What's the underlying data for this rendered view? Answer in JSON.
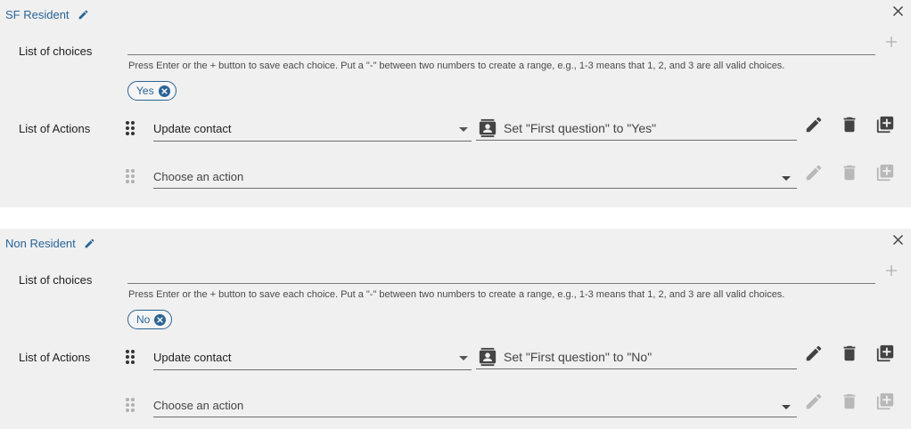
{
  "hint_text": "Press Enter or the + button to save each choice. Put a \"-\" between two numbers to create a range, e.g., 1-3 means that 1, 2, and 3 are all valid choices.",
  "labels": {
    "list_of_choices": "List of choices",
    "list_of_actions": "List of Actions",
    "choose_action_placeholder": "Choose an action"
  },
  "icons": {
    "edit": "pencil-icon",
    "close": "close-icon",
    "add": "plus-icon",
    "drag": "drag-handle-icon",
    "contact": "contact-icon",
    "delete": "trash-icon",
    "duplicate": "add-box-icon"
  },
  "colors": {
    "accent": "#2a6496",
    "card_bg": "#f0f0f0",
    "icon_dark": "#424242",
    "icon_disabled": "#b8b8b8"
  },
  "cards": [
    {
      "title": "SF Resident",
      "chips": [
        "Yes"
      ],
      "action": {
        "type": "Update contact",
        "summary": "Set \"First question\" to \"Yes\""
      }
    },
    {
      "title": "Non Resident",
      "chips": [
        "No"
      ],
      "action": {
        "type": "Update contact",
        "summary": "Set \"First question\" to \"No\""
      }
    }
  ]
}
